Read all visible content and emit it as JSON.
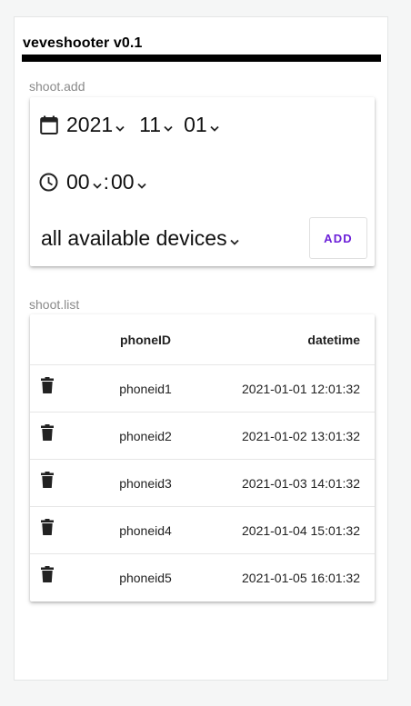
{
  "app": {
    "title": "veveshooter v0.1"
  },
  "add": {
    "section_label": "shoot.add",
    "date": {
      "year": "2021",
      "month": "11",
      "day": "01"
    },
    "time": {
      "hour": "00",
      "minute": "00",
      "separator": ":"
    },
    "device": "all available devices",
    "add_label": "ADD"
  },
  "list": {
    "section_label": "shoot.list",
    "columns": {
      "phone": "phoneID",
      "datetime": "datetime"
    },
    "rows": [
      {
        "phone": "phoneid1",
        "datetime": "2021-01-01 12:01:32"
      },
      {
        "phone": "phoneid2",
        "datetime": "2021-01-02 13:01:32"
      },
      {
        "phone": "phoneid3",
        "datetime": "2021-01-03 14:01:32"
      },
      {
        "phone": "phoneid4",
        "datetime": "2021-01-04 15:01:32"
      },
      {
        "phone": "phoneid5",
        "datetime": "2021-01-05 16:01:32"
      }
    ]
  },
  "colors": {
    "accent": "#6b1fd8",
    "rule": "#000000",
    "muted": "#8a8a8a"
  }
}
